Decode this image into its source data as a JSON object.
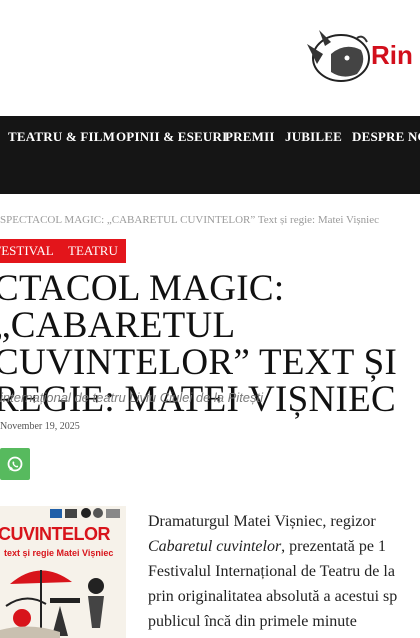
{
  "header": {
    "logo_text": "Rin"
  },
  "nav": {
    "items": [
      "TEATRU & FILM",
      "OPINII & ESEURI",
      "PREMII",
      "JUBILEE",
      "DESPRE NOI"
    ]
  },
  "breadcrumb": "SPECTACOL MAGIC: „CABARETUL   CUVINTELOR” Text și regie: Matei Vișniec",
  "tags": [
    "FESTIVAL",
    "TEATRU"
  ],
  "article": {
    "title": "CTACOL MAGIC: „CABARETUL CUVINTELOR” TEXT ȘI REGIE: MATEI VIȘNIEC",
    "subtitle": "internațional de teatru Liviu Ciulei de la Pitești",
    "date": "November 19, 2025",
    "poster_title": "CUVINTELOR",
    "poster_subtitle": "text și regie Matei Vișniec",
    "body_1": "Dramaturgul Matei Vișniec, regizor",
    "body_2": "Cabaretul cuvintelor",
    "body_3": ", prezentată pe 1",
    "body_4": "Festivalul Internațional de Teatru de la",
    "body_5": "prin originalitatea absolută a acestui sp",
    "body_6": "publicul încă din primele minute"
  },
  "colors": {
    "accent": "#e3151b",
    "nav_bg": "#151515",
    "whatsapp": "#57ba5e"
  },
  "icons": {
    "share": "whatsapp-icon",
    "logo": "rhino-logo"
  }
}
